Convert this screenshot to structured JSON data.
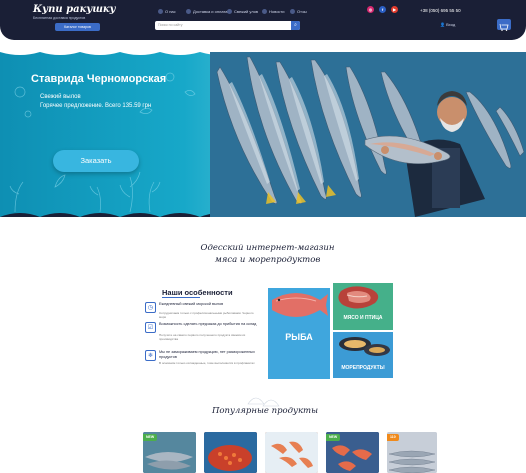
{
  "header": {
    "logo_title": "Купи ракушку",
    "logo_subtitle": "Бесплатная доставка продуктов",
    "catalog_button": "Каталог товаров",
    "menu": [
      {
        "label": "О нас",
        "icon": "info-icon"
      },
      {
        "label": "Доставка и оплата",
        "icon": "truck-icon"
      },
      {
        "label": "Свежий улов",
        "icon": "fish-icon"
      },
      {
        "label": "Новости",
        "icon": "news-icon"
      },
      {
        "label": "Отзы",
        "icon": "reviews-icon"
      }
    ],
    "search_placeholder": "Поиск по сайту",
    "socials": [
      {
        "name": "instagram-icon",
        "color": "#d6286f"
      },
      {
        "name": "facebook-icon",
        "color": "#2b5fc4"
      },
      {
        "name": "youtube-icon",
        "color": "#e23b2c"
      }
    ],
    "phone": "+38 (050) 695 55 50",
    "login": "Вход"
  },
  "hero": {
    "title": "Ставрида Черноморская",
    "line1": "Свежий вылов",
    "line2": "Горячее предложение. Всего 135.59 грн",
    "button": "Заказать"
  },
  "intro": {
    "heading_line1": "Одесский интернет-магазин",
    "heading_line2": "мяса и морепродуктов"
  },
  "features": {
    "title": "Наши особенности",
    "items": [
      {
        "heading": "Ежедневный свежий морской вылов",
        "text": "Сотрудничаем только с профессиональными рыболовами. Черного моря",
        "icon": "fish-calendar-icon"
      },
      {
        "heading": "Возможность сделать предзаказ до прибытия на склад",
        "text": "Получите на самого первого полученного продукта свежим из производства",
        "icon": "checklist-icon"
      },
      {
        "heading": "Мы не замораживаем продукцию, нет размороженных продуктов",
        "text": "В основном только охлажденные, тоже выполняются в профпакетах",
        "icon": "snowflake-icon"
      }
    ]
  },
  "categories": [
    {
      "label": "РЫБА",
      "color": "#3fa6dd"
    },
    {
      "label": "МЯСО И ПТИЦА",
      "color": "#45b08a"
    },
    {
      "label": "МОРЕПРОДУКТЫ",
      "color": "#3c9bd5"
    }
  ],
  "popular": {
    "title": "Популярные продукты",
    "products": [
      {
        "badge": "NEW",
        "badge_color": "#4cae4c"
      },
      {
        "badge": "",
        "badge_color": ""
      },
      {
        "badge": "",
        "badge_color": ""
      },
      {
        "badge": "NEW",
        "badge_color": "#4cae4c"
      },
      {
        "badge": "110",
        "badge_color": "#f08a1c"
      }
    ]
  }
}
